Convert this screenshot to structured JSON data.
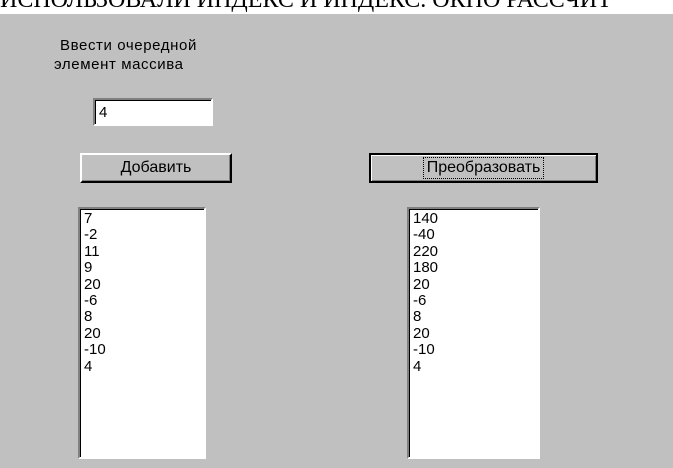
{
  "page": {
    "top_text": "ИСПОЛЬЗОВАЛИ ИНДЕКС И ИНДЕКС. ОКНО РАССЧИТ"
  },
  "form": {
    "prompt_line1": "Ввести  очередной",
    "prompt_line2": "элемент  массива",
    "input_value": "4",
    "add_button": "Добавить",
    "convert_button": "Преобразовать",
    "left_list": [
      "7",
      "-2",
      "11",
      "9",
      "20",
      "-6",
      "8",
      "20",
      "-10",
      "4"
    ],
    "right_list": [
      "140",
      "-40",
      "220",
      "180",
      "20",
      "-6",
      "8",
      "20",
      "-10",
      "4"
    ]
  },
  "colors": {
    "form_bg": "#c0c0c0",
    "field_bg": "#ffffff"
  }
}
